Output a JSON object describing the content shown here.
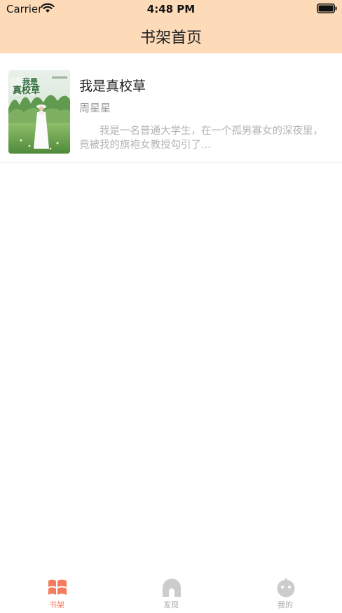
{
  "status_bar": {
    "carrier": "Carrier",
    "time": "4:48 PM"
  },
  "header": {
    "title": "书架首页"
  },
  "books": [
    {
      "title": "我是真校草",
      "author": "周星星",
      "description": "我是一名普通大学生，在一个孤男寡女的深夜里，竟被我的旗袍女教授勾引了...",
      "cover_text": "我是真校草"
    }
  ],
  "tabbar": {
    "items": [
      {
        "label": "书架",
        "active": true
      },
      {
        "label": "发现",
        "active": false
      },
      {
        "label": "我的",
        "active": false
      }
    ]
  },
  "colors": {
    "header_bg": "#fddab8",
    "accent": "#f47b5e",
    "inactive": "#cccccc"
  }
}
